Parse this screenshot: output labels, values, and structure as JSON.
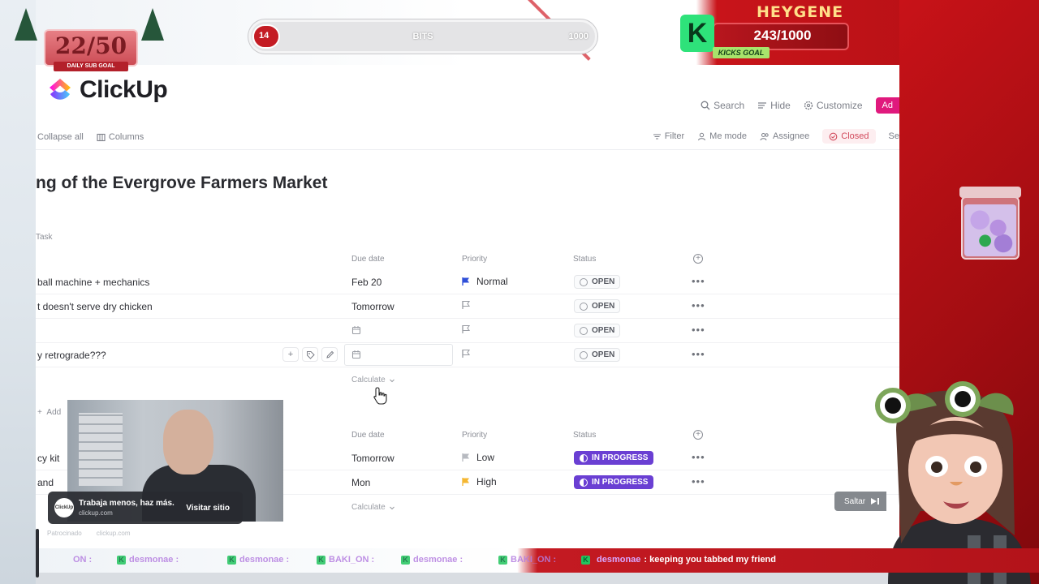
{
  "app": {
    "logo_text": "ClickUp",
    "topbar": {
      "search": "Search",
      "hide": "Hide",
      "customize": "Customize",
      "add": "Ad"
    },
    "toolbar": {
      "collapse_all": "Collapse all",
      "columns": "Columns",
      "filter": "Filter",
      "me_mode": "Me mode",
      "assignee": "Assignee",
      "closed": "Closed",
      "search_trunc": "Se"
    },
    "title": "ng of the Evergrove Farmers Market",
    "task_header": "Task",
    "columns": {
      "due": "Due date",
      "priority": "Priority",
      "status": "Status"
    },
    "group1": {
      "rows": [
        {
          "name": "ball machine + mechanics",
          "due": "Feb 20",
          "priority": "Normal",
          "priority_color": "#2f4fd8",
          "status": "OPEN"
        },
        {
          "name": "t doesn't serve dry chicken",
          "due": "Tomorrow",
          "priority": "",
          "priority_color": "#9a9da4",
          "status": "OPEN"
        },
        {
          "name": "",
          "due": "",
          "priority": "",
          "priority_color": "#9a9da4",
          "status": "OPEN"
        },
        {
          "name": "y retrograde???",
          "due": "",
          "priority": "",
          "priority_color": "#9a9da4",
          "status": "OPEN"
        }
      ],
      "calculate": "Calculate"
    },
    "add_task": "Add",
    "group2": {
      "rows": [
        {
          "name": "cy kit",
          "due": "Tomorrow",
          "priority": "Low",
          "priority_color": "#b7bac0",
          "status": "IN PROGRESS"
        },
        {
          "name": "and",
          "due": "Mon",
          "priority": "High",
          "priority_color": "#f5b731",
          "status": "IN PROGRESS"
        }
      ],
      "calculate": "Calculate"
    }
  },
  "ad": {
    "tagline": "Trabaja menos, haz más.",
    "domain": "clickup.com",
    "cta": "Visitar sitio",
    "logo_text": "ClickUp",
    "sponsored": "Patrocinado",
    "sponsored_domain": "clickup.com",
    "skip": "Saltar"
  },
  "stream": {
    "sub_goal": {
      "value": "22/50",
      "label": "DAILY SUB GOAL"
    },
    "bits": {
      "current": "14",
      "label": "BITS",
      "target": "1000",
      "progress": 0.014
    },
    "kicks": {
      "user": "HEYGENE",
      "value": "243/1000",
      "label": "KICKS GOAL"
    },
    "chat": {
      "ghost_items": [
        "ON :",
        "desmonae :",
        "desmonae :",
        "BAKI_ON :",
        "desmonae :",
        "BAKI_ON :"
      ],
      "live_user": "desmonae",
      "live_message": ": keeping you tabbed my friend"
    }
  }
}
